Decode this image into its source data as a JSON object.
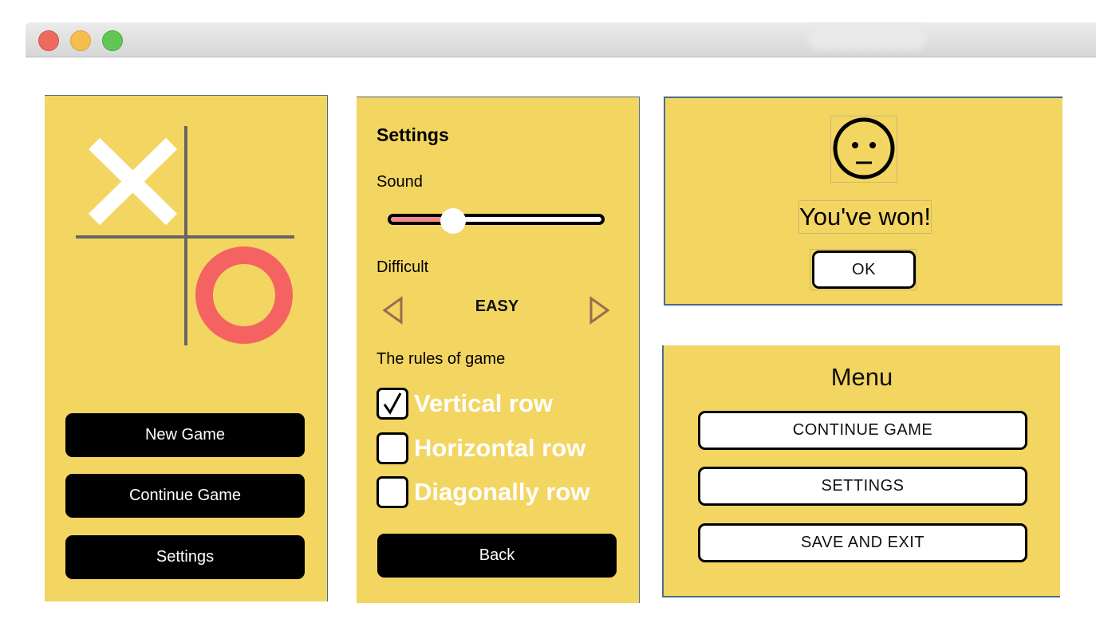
{
  "window": {
    "controls": [
      "close",
      "minimize",
      "maximize"
    ]
  },
  "main_menu": {
    "new_game": "New Game",
    "continue_game": "Continue Game",
    "settings": "Settings",
    "colors": {
      "x_mark": "#ffffff",
      "o_mark": "#f56262",
      "grid": "#666666"
    }
  },
  "settings": {
    "title": "Settings",
    "sound_label": "Sound",
    "sound_level": 0.3,
    "difficulty_label": "Difficult",
    "difficulty_value": "EASY",
    "rules_label": "The rules of game",
    "rules": [
      {
        "label": "Vertical row",
        "checked": true
      },
      {
        "label": "Horizontal row",
        "checked": false
      },
      {
        "label": "Diagonally row",
        "checked": false
      }
    ],
    "back": "Back"
  },
  "result_dialog": {
    "icon": "neutral-face-icon",
    "message": "You've won!",
    "ok": "OK"
  },
  "pause_menu": {
    "title": "Menu",
    "continue_game": "CONTINUE GAME",
    "settings": "SETTINGS",
    "save_and_exit": "SAVE AND EXIT"
  },
  "colors": {
    "panel_bg": "#f3d562",
    "button_dark": "#000000",
    "arrow": "#9b6b4f"
  }
}
